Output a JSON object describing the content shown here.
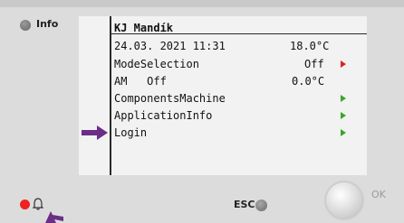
{
  "panel": {
    "info_label": "Info",
    "esc_label": "ESC",
    "ok_label": "OK"
  },
  "display": {
    "title": "KJ Mandík",
    "datetime": "24.03. 2021 11:31",
    "temperature": "18.0°C",
    "rows": [
      {
        "label": "ModeSelection",
        "value": "Off",
        "arrow": "red"
      },
      {
        "label": "AM   Off",
        "value": "0.0°C",
        "arrow": ""
      },
      {
        "label": "ComponentsMachine",
        "value": "",
        "arrow": "green"
      },
      {
        "label": "ApplicationInfo",
        "value": "",
        "arrow": "green"
      },
      {
        "label": "Login",
        "value": "",
        "arrow": "green"
      }
    ]
  },
  "colors": {
    "accent_arrow": "#6b2d86",
    "nav_arrow_green": "#3aa52a",
    "nav_arrow_red": "#e02020",
    "alarm_led": "#ee2222"
  },
  "icons": {
    "alarm": "bell-icon",
    "pointer": "purple-arrow-icon"
  }
}
